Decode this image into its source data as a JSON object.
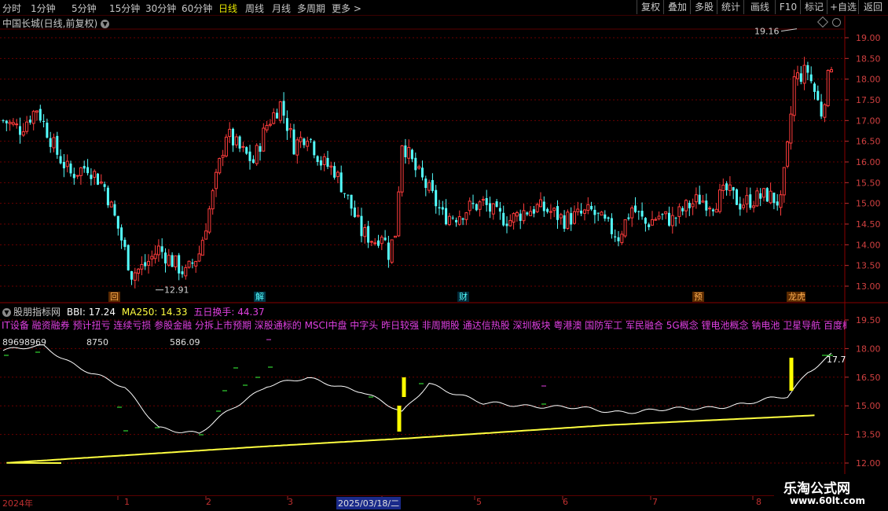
{
  "toolbar": {
    "periods": [
      "分时",
      "1分钟",
      "5分钟",
      "15分钟",
      "30分钟",
      "60分钟",
      "日线",
      "周线",
      "月线",
      "多周期",
      "更多 >"
    ],
    "active": "日线",
    "right_buttons": [
      "复权",
      "叠加",
      "多股",
      "统计",
      "画线",
      "F10",
      "标记",
      "+自选",
      "返回"
    ]
  },
  "main_title": "中国长城(日线,前复权)",
  "colors": {
    "up": "#ff3c3c",
    "down": "#54ffff",
    "grid": "#6a0000",
    "bbi": "#ffffff",
    "ma250": "#ffff40",
    "concept": "#e040e0"
  },
  "event_tags": [
    {
      "label": "回",
      "color": "#ffb050",
      "bg": "#5a2a00"
    },
    {
      "label": "解",
      "color": "#54ffff",
      "bg": "#003a4a"
    },
    {
      "label": "财",
      "color": "#54ffff",
      "bg": "#002a3a"
    },
    {
      "label": "预",
      "color": "#ffb050",
      "bg": "#5a2a00"
    },
    {
      "label": "龙虎榜",
      "color": "#ffb050",
      "bg": "#5a2a00"
    }
  ],
  "indicator": {
    "name": "股朋指标网",
    "bbi_label": "BBI: 17.24",
    "ma250_label": "MA250: 14.33",
    "turnover_label": "五日换手: 44.37",
    "concepts": "IT设备 融资融券 预计扭亏 连续亏损 参股金融 分拆上市预期 深股通标的 MSCI中盘 中字头 昨日较强 非周期股 通达信热股 深圳板块 粤港澳 国防军工 军民融合 5G概念 锂电池概念 钠电池 卫星导航 百度概念",
    "values": [
      "89698969",
      "8750",
      "586.09"
    ],
    "last_value": "17.7"
  },
  "bottom_axis": {
    "labels": [
      "2024年",
      "1",
      "2",
      "3",
      "2025/03/18/二",
      "5",
      "6",
      "7",
      "8"
    ]
  },
  "logo": {
    "name": "乐淘公式网",
    "url": "www.60lt.com"
  },
  "chart_data": [
    {
      "type": "candlestick",
      "title": "中国长城(日线,前复权)",
      "y_ticks": [
        "19.00",
        "18.50",
        "18.00",
        "17.50",
        "17.00",
        "16.50",
        "16.00",
        "15.50",
        "15.00",
        "14.50",
        "14.00",
        "13.50",
        "13.00"
      ],
      "ylim": [
        12.8,
        19.3
      ],
      "annotations": [
        {
          "label": "19.16",
          "value": 19.16
        },
        {
          "label": "12.91",
          "value": 12.91
        }
      ],
      "anchors": [
        [
          0,
          17.0
        ],
        [
          5,
          16.8
        ],
        [
          10,
          17.3
        ],
        [
          16,
          16.2
        ],
        [
          20,
          15.7
        ],
        [
          25,
          15.9
        ],
        [
          30,
          15.4
        ],
        [
          34,
          14.4
        ],
        [
          38,
          13.3
        ],
        [
          42,
          13.5
        ],
        [
          46,
          13.9
        ],
        [
          50,
          13.6
        ],
        [
          54,
          13.3
        ],
        [
          58,
          13.8
        ],
        [
          62,
          15.2
        ],
        [
          66,
          16.7
        ],
        [
          70,
          16.3
        ],
        [
          74,
          16.0
        ],
        [
          78,
          16.9
        ],
        [
          82,
          17.4
        ],
        [
          86,
          16.4
        ],
        [
          90,
          16.7
        ],
        [
          94,
          16.0
        ],
        [
          98,
          15.8
        ],
        [
          102,
          15.1
        ],
        [
          106,
          14.3
        ],
        [
          110,
          14.1
        ],
        [
          112,
          14.3
        ],
        [
          114,
          13.8
        ],
        [
          116,
          14.3
        ],
        [
          118,
          16.5
        ],
        [
          122,
          15.8
        ],
        [
          126,
          15.3
        ],
        [
          130,
          14.7
        ],
        [
          134,
          14.7
        ],
        [
          138,
          14.9
        ],
        [
          142,
          15.0
        ],
        [
          146,
          14.7
        ],
        [
          150,
          14.6
        ],
        [
          154,
          14.8
        ],
        [
          158,
          14.9
        ],
        [
          162,
          14.8
        ],
        [
          166,
          14.6
        ],
        [
          170,
          14.7
        ],
        [
          174,
          14.8
        ],
        [
          178,
          14.5
        ],
        [
          182,
          14.2
        ],
        [
          186,
          14.9
        ],
        [
          190,
          14.5
        ],
        [
          194,
          14.7
        ],
        [
          198,
          14.6
        ],
        [
          202,
          14.9
        ],
        [
          206,
          15.1
        ],
        [
          210,
          15.0
        ],
        [
          214,
          15.3
        ],
        [
          218,
          15.0
        ],
        [
          222,
          15.1
        ],
        [
          226,
          15.2
        ],
        [
          230,
          15.0
        ],
        [
          232,
          16.3
        ],
        [
          234,
          18.0
        ],
        [
          238,
          18.2
        ],
        [
          242,
          17.2
        ],
        [
          245,
          18.4
        ]
      ]
    },
    {
      "type": "line",
      "y_ticks": [
        "19.50",
        "18.00",
        "16.50",
        "15.00",
        "13.50",
        "12.00"
      ],
      "ylim": [
        11.6,
        20.2
      ],
      "series": [
        {
          "name": "BBI",
          "values": [
            [
              0,
              17.9
            ],
            [
              12,
              18.1
            ],
            [
              22,
              17.1
            ],
            [
              36,
              15.9
            ],
            [
              46,
              13.9
            ],
            [
              58,
              13.5
            ],
            [
              68,
              14.9
            ],
            [
              78,
              16.1
            ],
            [
              90,
              16.4
            ],
            [
              106,
              15.8
            ],
            [
              118,
              14.6
            ],
            [
              126,
              16.2
            ],
            [
              142,
              15.1
            ],
            [
              160,
              15.0
            ],
            [
              180,
              14.7
            ],
            [
              200,
              14.8
            ],
            [
              220,
              15.1
            ],
            [
              232,
              15.5
            ],
            [
              238,
              16.8
            ],
            [
              245,
              17.7
            ]
          ]
        },
        {
          "name": "MA250",
          "values": [
            [
              0,
              12.0
            ],
            [
              80,
              12.9
            ],
            [
              120,
              13.3
            ],
            [
              180,
              14.0
            ],
            [
              240,
              14.5
            ]
          ]
        }
      ]
    }
  ]
}
